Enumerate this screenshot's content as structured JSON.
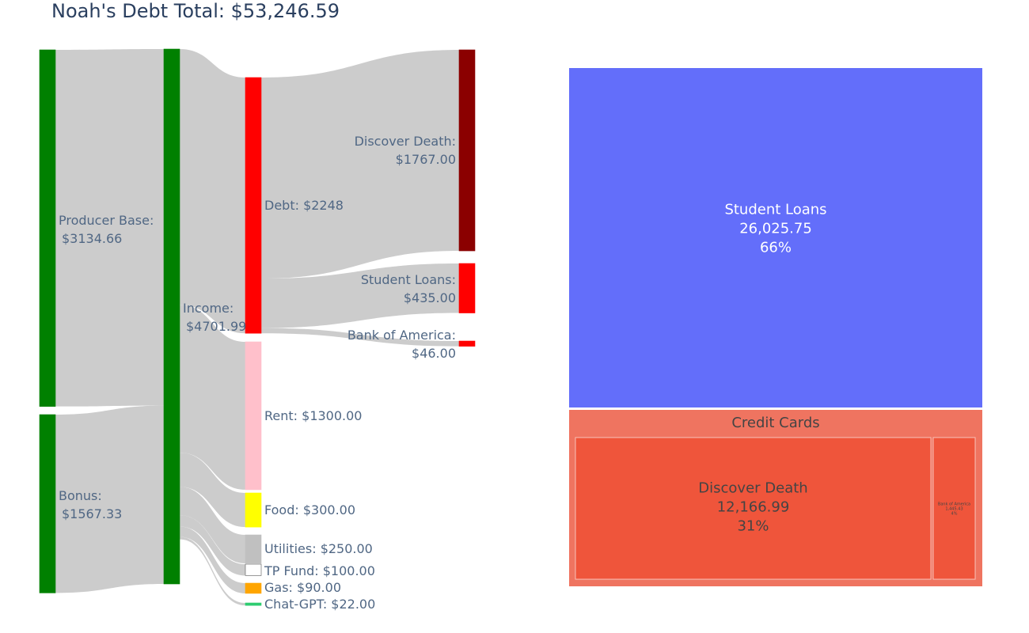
{
  "title": "Noah's Debt Total: $53,246.59",
  "chart_data": [
    {
      "type": "sankey",
      "nodes": [
        {
          "id": "producer_base",
          "label_lines": [
            "Producer Base:",
            "$3134.66"
          ],
          "value": 3134.66,
          "color": "#008000"
        },
        {
          "id": "bonus",
          "label_lines": [
            "Bonus:",
            "$1567.33"
          ],
          "value": 1567.33,
          "color": "#008000"
        },
        {
          "id": "income",
          "label_lines": [
            "Income:",
            "$4701.99"
          ],
          "value": 4701.99,
          "color": "#008000"
        },
        {
          "id": "debt",
          "label_lines": [
            "Debt: $2248"
          ],
          "value": 2248,
          "color": "#ff0000"
        },
        {
          "id": "rent",
          "label_lines": [
            "Rent: $1300.00"
          ],
          "value": 1300.0,
          "color": "#ffc0cb"
        },
        {
          "id": "food",
          "label_lines": [
            "Food: $300.00"
          ],
          "value": 300.0,
          "color": "#ffff00"
        },
        {
          "id": "utilities",
          "label_lines": [
            "Utilities: $250.00"
          ],
          "value": 250.0,
          "color": "#c0c0c0"
        },
        {
          "id": "tp_fund",
          "label_lines": [
            "TP Fund: $100.00"
          ],
          "value": 100.0,
          "color": "#ffffff"
        },
        {
          "id": "gas",
          "label_lines": [
            "Gas: $90.00"
          ],
          "value": 90.0,
          "color": "#ffa500"
        },
        {
          "id": "chatgpt",
          "label_lines": [
            "Chat-GPT: $22.00"
          ],
          "value": 22.0,
          "color": "#2ecc71"
        },
        {
          "id": "discover",
          "label_lines": [
            "Discover Death:",
            "$1767.00"
          ],
          "value": 1767.0,
          "color": "#8b0000"
        },
        {
          "id": "student",
          "label_lines": [
            "Student Loans:",
            "$435.00"
          ],
          "value": 435.0,
          "color": "#ff0000"
        },
        {
          "id": "boa",
          "label_lines": [
            "Bank of America:",
            "$46.00"
          ],
          "value": 46.0,
          "color": "#ff0000"
        }
      ],
      "links": [
        {
          "source": "producer_base",
          "target": "income",
          "value": 3134.66
        },
        {
          "source": "bonus",
          "target": "income",
          "value": 1567.33
        },
        {
          "source": "income",
          "target": "debt",
          "value": 2248
        },
        {
          "source": "income",
          "target": "rent",
          "value": 1300.0
        },
        {
          "source": "income",
          "target": "food",
          "value": 300.0
        },
        {
          "source": "income",
          "target": "utilities",
          "value": 250.0
        },
        {
          "source": "income",
          "target": "tp_fund",
          "value": 100.0
        },
        {
          "source": "income",
          "target": "gas",
          "value": 90.0
        },
        {
          "source": "income",
          "target": "chatgpt",
          "value": 22.0
        },
        {
          "source": "debt",
          "target": "discover",
          "value": 1767.0
        },
        {
          "source": "debt",
          "target": "student",
          "value": 435.0
        },
        {
          "source": "debt",
          "target": "boa",
          "value": 46.0
        }
      ],
      "link_color": "#cccccc"
    },
    {
      "type": "treemap",
      "items": [
        {
          "id": "student_loans",
          "label": "Student Loans",
          "value_text": "26,025.75",
          "percent_text": "66%",
          "value": 26025.75,
          "color": "#636efa"
        },
        {
          "id": "credit_cards",
          "label": "Credit Cards",
          "color": "#ef7460",
          "value": 13612.0,
          "children": [
            {
              "id": "discover_death",
              "label": "Discover Death",
              "value_text": "12,166.99",
              "percent_text": "31%",
              "value": 12166.99,
              "color": "#ef553b"
            },
            {
              "id": "bank_of_america",
              "label": "Bank of America",
              "value_text": "1,445.43",
              "percent_text": "4%",
              "value": 1445.43,
              "color": "#ef553b"
            }
          ]
        }
      ]
    }
  ]
}
